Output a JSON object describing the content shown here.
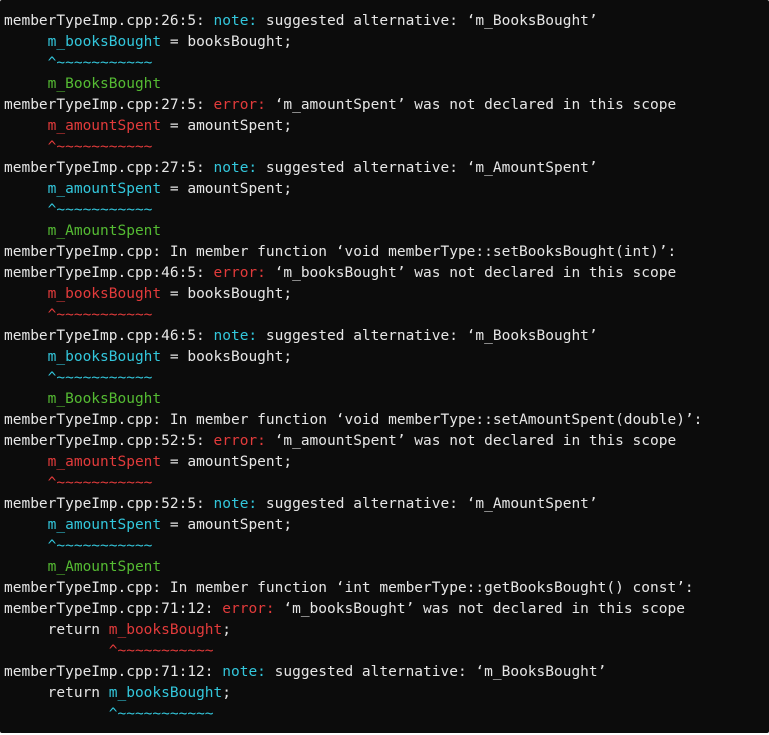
{
  "terminal": {
    "colors": {
      "background": "#0c0c0c",
      "text": "#e6e6e6",
      "note": "#33c7dc",
      "error": "#e23b3b",
      "fixit": "#55bb33"
    },
    "lines": [
      [
        {
          "t": "memberTypeImp.cpp:26:5: ",
          "c": "plain"
        },
        {
          "t": "note:",
          "c": "note"
        },
        {
          "t": " suggested alternative: ‘m_BooksBought’",
          "c": "plain"
        }
      ],
      [
        {
          "t": "     ",
          "c": "plain"
        },
        {
          "t": "m_booksBought",
          "c": "note"
        },
        {
          "t": " = booksBought;",
          "c": "plain"
        }
      ],
      [
        {
          "t": "     ",
          "c": "plain"
        },
        {
          "t": "^~~~~~~~~~~~",
          "c": "note"
        }
      ],
      [
        {
          "t": "     ",
          "c": "plain"
        },
        {
          "t": "m_BooksBought",
          "c": "fix"
        }
      ],
      [
        {
          "t": "memberTypeImp.cpp:27:5: ",
          "c": "plain"
        },
        {
          "t": "error:",
          "c": "err"
        },
        {
          "t": " ‘m_amountSpent’ was not declared in this scope",
          "c": "plain"
        }
      ],
      [
        {
          "t": "     ",
          "c": "plain"
        },
        {
          "t": "m_amountSpent",
          "c": "err"
        },
        {
          "t": " = amountSpent;",
          "c": "plain"
        }
      ],
      [
        {
          "t": "     ",
          "c": "plain"
        },
        {
          "t": "^~~~~~~~~~~~",
          "c": "err"
        }
      ],
      [
        {
          "t": "memberTypeImp.cpp:27:5: ",
          "c": "plain"
        },
        {
          "t": "note:",
          "c": "note"
        },
        {
          "t": " suggested alternative: ‘m_AmountSpent’",
          "c": "plain"
        }
      ],
      [
        {
          "t": "     ",
          "c": "plain"
        },
        {
          "t": "m_amountSpent",
          "c": "note"
        },
        {
          "t": " = amountSpent;",
          "c": "plain"
        }
      ],
      [
        {
          "t": "     ",
          "c": "plain"
        },
        {
          "t": "^~~~~~~~~~~~",
          "c": "note"
        }
      ],
      [
        {
          "t": "     ",
          "c": "plain"
        },
        {
          "t": "m_AmountSpent",
          "c": "fix"
        }
      ],
      [
        {
          "t": "memberTypeImp.cpp: In member function ‘void memberType::setBooksBought(int)’:",
          "c": "plain"
        }
      ],
      [
        {
          "t": "memberTypeImp.cpp:46:5: ",
          "c": "plain"
        },
        {
          "t": "error:",
          "c": "err"
        },
        {
          "t": " ‘m_booksBought’ was not declared in this scope",
          "c": "plain"
        }
      ],
      [
        {
          "t": "     ",
          "c": "plain"
        },
        {
          "t": "m_booksBought",
          "c": "err"
        },
        {
          "t": " = booksBought;",
          "c": "plain"
        }
      ],
      [
        {
          "t": "     ",
          "c": "plain"
        },
        {
          "t": "^~~~~~~~~~~~",
          "c": "err"
        }
      ],
      [
        {
          "t": "memberTypeImp.cpp:46:5: ",
          "c": "plain"
        },
        {
          "t": "note:",
          "c": "note"
        },
        {
          "t": " suggested alternative: ‘m_BooksBought’",
          "c": "plain"
        }
      ],
      [
        {
          "t": "     ",
          "c": "plain"
        },
        {
          "t": "m_booksBought",
          "c": "note"
        },
        {
          "t": " = booksBought;",
          "c": "plain"
        }
      ],
      [
        {
          "t": "     ",
          "c": "plain"
        },
        {
          "t": "^~~~~~~~~~~~",
          "c": "note"
        }
      ],
      [
        {
          "t": "     ",
          "c": "plain"
        },
        {
          "t": "m_BooksBought",
          "c": "fix"
        }
      ],
      [
        {
          "t": "memberTypeImp.cpp: In member function ‘void memberType::setAmountSpent(double)’:",
          "c": "plain"
        }
      ],
      [
        {
          "t": "memberTypeImp.cpp:52:5: ",
          "c": "plain"
        },
        {
          "t": "error:",
          "c": "err"
        },
        {
          "t": " ‘m_amountSpent’ was not declared in this scope",
          "c": "plain"
        }
      ],
      [
        {
          "t": "     ",
          "c": "plain"
        },
        {
          "t": "m_amountSpent",
          "c": "err"
        },
        {
          "t": " = amountSpent;",
          "c": "plain"
        }
      ],
      [
        {
          "t": "     ",
          "c": "plain"
        },
        {
          "t": "^~~~~~~~~~~~",
          "c": "err"
        }
      ],
      [
        {
          "t": "memberTypeImp.cpp:52:5: ",
          "c": "plain"
        },
        {
          "t": "note:",
          "c": "note"
        },
        {
          "t": " suggested alternative: ‘m_AmountSpent’",
          "c": "plain"
        }
      ],
      [
        {
          "t": "     ",
          "c": "plain"
        },
        {
          "t": "m_amountSpent",
          "c": "note"
        },
        {
          "t": " = amountSpent;",
          "c": "plain"
        }
      ],
      [
        {
          "t": "     ",
          "c": "plain"
        },
        {
          "t": "^~~~~~~~~~~~",
          "c": "note"
        }
      ],
      [
        {
          "t": "     ",
          "c": "plain"
        },
        {
          "t": "m_AmountSpent",
          "c": "fix"
        }
      ],
      [
        {
          "t": "memberTypeImp.cpp: In member function ‘int memberType::getBooksBought() const’:",
          "c": "plain"
        }
      ],
      [
        {
          "t": "memberTypeImp.cpp:71:12: ",
          "c": "plain"
        },
        {
          "t": "error:",
          "c": "err"
        },
        {
          "t": " ‘m_booksBought’ was not declared in this scope",
          "c": "plain"
        }
      ],
      [
        {
          "t": "     return ",
          "c": "plain"
        },
        {
          "t": "m_booksBought",
          "c": "err"
        },
        {
          "t": ";",
          "c": "plain"
        }
      ],
      [
        {
          "t": "            ",
          "c": "plain"
        },
        {
          "t": "^~~~~~~~~~~~",
          "c": "err"
        }
      ],
      [
        {
          "t": "memberTypeImp.cpp:71:12: ",
          "c": "plain"
        },
        {
          "t": "note:",
          "c": "note"
        },
        {
          "t": " suggested alternative: ‘m_BooksBought’",
          "c": "plain"
        }
      ],
      [
        {
          "t": "     return ",
          "c": "plain"
        },
        {
          "t": "m_booksBought",
          "c": "note"
        },
        {
          "t": ";",
          "c": "plain"
        }
      ],
      [
        {
          "t": "            ",
          "c": "plain"
        },
        {
          "t": "^~~~~~~~~~~~",
          "c": "note"
        }
      ]
    ]
  }
}
